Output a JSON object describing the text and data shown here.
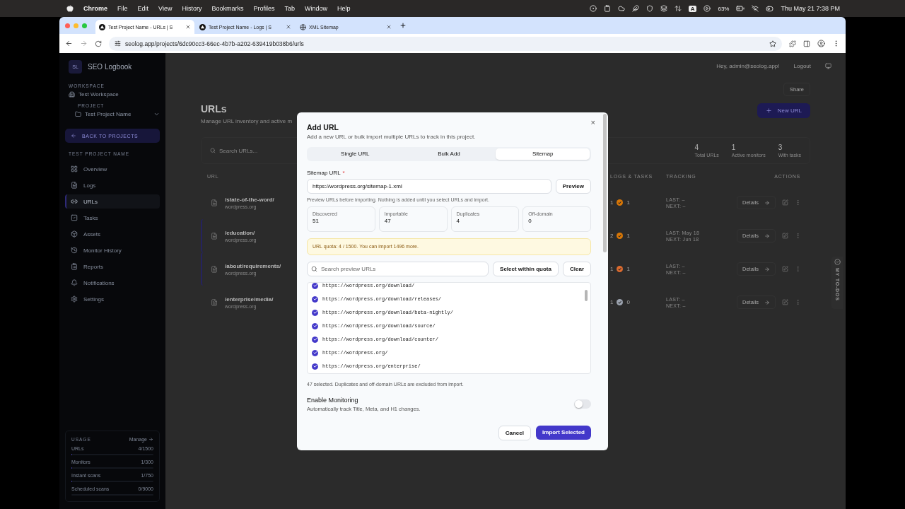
{
  "menubar": {
    "app": "Chrome",
    "menus": [
      "File",
      "Edit",
      "View",
      "History",
      "Bookmarks",
      "Profiles",
      "Tab",
      "Window",
      "Help"
    ],
    "input_source": "A",
    "battery": "63%",
    "clock": "Thu May 21  7:38 PM"
  },
  "browser": {
    "tabs": [
      {
        "title": "Test Project Name - URLs | S",
        "selected": true
      },
      {
        "title": "Test Project Name - Logs | S",
        "selected": false
      },
      {
        "title": "XML Sitemap",
        "selected": false
      }
    ],
    "address": "seolog.app/projects/6dc90cc3-66ec-4b7b-a202-639419b038b6/urls"
  },
  "sidebar": {
    "logo": "SL",
    "brand": "SEO Logbook",
    "workspace_label": "WORKSPACE",
    "workspace": "Test Workspace",
    "project_label": "PROJECT",
    "project": "Test Project Name",
    "back": "BACK TO PROJECTS",
    "section": "TEST PROJECT NAME",
    "items": [
      {
        "label": "Overview",
        "selected": false
      },
      {
        "label": "Logs",
        "selected": false
      },
      {
        "label": "URLs",
        "selected": true
      },
      {
        "label": "Tasks",
        "selected": false
      },
      {
        "label": "Assets",
        "selected": false
      },
      {
        "label": "Monitor History",
        "selected": false
      },
      {
        "label": "Reports",
        "selected": false
      },
      {
        "label": "Notifications",
        "selected": false
      },
      {
        "label": "Settings",
        "selected": false
      }
    ],
    "usage": {
      "title": "USAGE",
      "manage": "Manage",
      "rows": [
        {
          "label": "URLs",
          "value": "4/1500",
          "level": 0.003
        },
        {
          "label": "Monitors",
          "value": "1/300",
          "level": 0.003
        },
        {
          "label": "Instant scans",
          "value": "1/750",
          "level": 0.001
        },
        {
          "label": "Scheduled scans",
          "value": "0/9000",
          "level": 0
        }
      ]
    }
  },
  "header": {
    "greeting": "Hey, admin@seolog.app!",
    "logout": "Logout",
    "share": "Share"
  },
  "page": {
    "title": "URLs",
    "subtitle": "Manage URL inventory and active m",
    "new_button": "New URL",
    "search_placeholder": "Search URLs...",
    "stats": [
      {
        "value": "4",
        "label": "Total URLs"
      },
      {
        "value": "1",
        "label": "Active monitors"
      },
      {
        "value": "3",
        "label": "With tasks"
      }
    ],
    "columns": [
      "URL",
      "LOGS & TASKS",
      "TRACKING",
      "ACTIONS"
    ],
    "rows": [
      {
        "path": "/state-of-the-word/",
        "domain": "wordpress.org",
        "logs": "1",
        "tasks": "1",
        "color": "#d97706",
        "last": "LAST: –",
        "next": "NEXT: –",
        "details": "Details",
        "highlighted": false
      },
      {
        "path": "/education/",
        "domain": "wordpress.org",
        "logs": "2",
        "tasks": "1",
        "color": "#d97706",
        "last": "LAST: May 18",
        "next": "NEXT: Jun 18",
        "details": "Details",
        "highlighted": true
      },
      {
        "path": "/about/requirements/",
        "domain": "wordpress.org",
        "logs": "1",
        "tasks": "1",
        "color": "#dc6b2f",
        "last": "LAST: –",
        "next": "NEXT: –",
        "details": "Details",
        "highlighted": true
      },
      {
        "path": "/enterprise/media/",
        "domain": "wordpress.org",
        "logs": "1",
        "tasks": "0",
        "color": "#9ca3af",
        "last": "LAST: –",
        "next": "NEXT: –",
        "details": "Details",
        "highlighted": false
      }
    ],
    "todos": "MY TO-DOS"
  },
  "dialog": {
    "title": "Add URL",
    "subtitle": "Add a new URL or bulk import multiple URLs to track in this project.",
    "close": "×",
    "tabs": [
      {
        "label": "Single URL",
        "selected": false
      },
      {
        "label": "Bulk Add",
        "selected": false
      },
      {
        "label": "Sitemap",
        "selected": true
      }
    ],
    "field_label": "Sitemap URL",
    "required": "*",
    "field_value": "https://wordpress.org/sitemap-1.xml",
    "preview": "Preview",
    "hint": "Preview URLs before importing. Nothing is added until you select URLs and import.",
    "stats": [
      {
        "label": "Discovered",
        "value": "51"
      },
      {
        "label": "Importable",
        "value": "47"
      },
      {
        "label": "Duplicates",
        "value": "4"
      },
      {
        "label": "Off-domain",
        "value": "0"
      }
    ],
    "quota": "URL quota: 4 / 1500. You can import 1496 more.",
    "search_placeholder": "Search preview URLs",
    "select_quota": "Select within quota",
    "clear": "Clear",
    "urls": [
      {
        "url": "https://wordpress.org/download/",
        "checked": true
      },
      {
        "url": "https://wordpress.org/download/releases/",
        "checked": true
      },
      {
        "url": "https://wordpress.org/download/beta-nightly/",
        "checked": true
      },
      {
        "url": "https://wordpress.org/download/source/",
        "checked": true
      },
      {
        "url": "https://wordpress.org/download/counter/",
        "checked": true
      },
      {
        "url": "https://wordpress.org/",
        "checked": true
      },
      {
        "url": "https://wordpress.org/enterprise/",
        "checked": true
      }
    ],
    "selected_note": "47 selected. Duplicates and off-domain URLs are excluded from import.",
    "monitoring": {
      "title": "Enable Monitoring",
      "description": "Automatically track Title, Meta, and H1 changes.",
      "on": false
    },
    "cancel": "Cancel",
    "import": "Import Selected"
  }
}
